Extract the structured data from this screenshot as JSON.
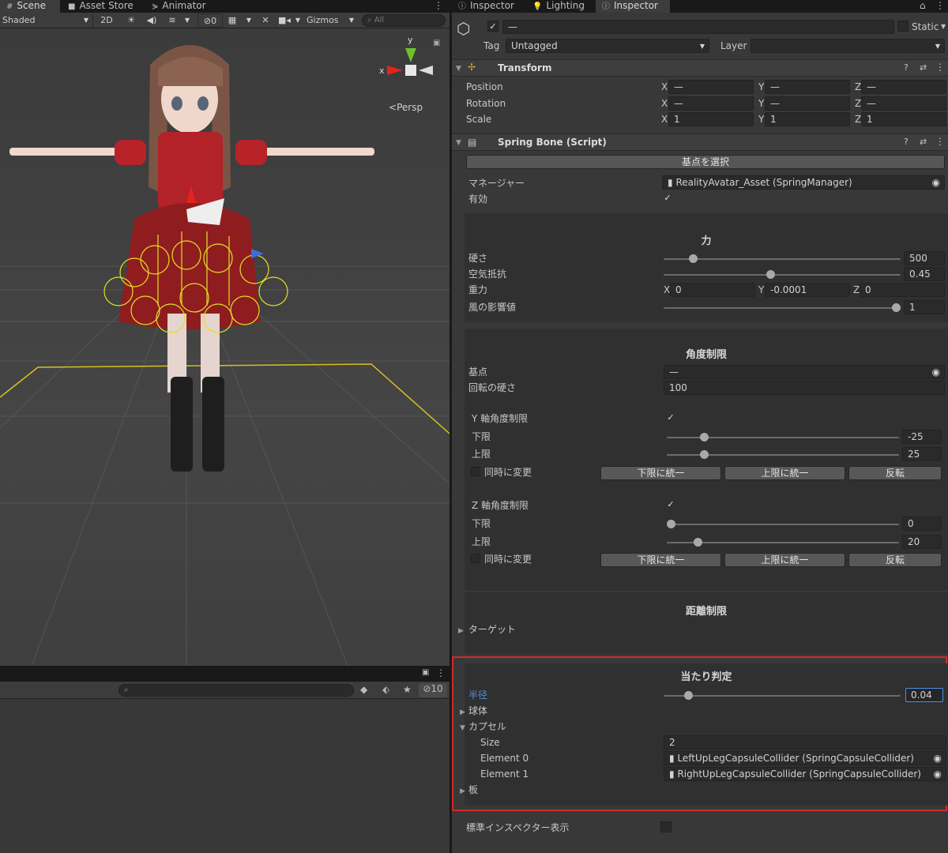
{
  "left_tabs": [
    {
      "label": "Scene"
    },
    {
      "label": "Asset Store"
    },
    {
      "label": "Animator"
    }
  ],
  "right_tabs": [
    {
      "label": "Inspector"
    },
    {
      "label": "Lighting"
    },
    {
      "label": "Inspector"
    }
  ],
  "scene_toolbar": {
    "shading": "Shaded",
    "mode_2d": "2D",
    "hidden_count": "0",
    "gizmos": "Gizmos",
    "search_placeholder": "All"
  },
  "scene": {
    "persp_label": "Persp",
    "gizmo_axes": {
      "x": "x",
      "y": "y"
    }
  },
  "hierarchy": {
    "hidden_count": "10"
  },
  "object": {
    "name": "—",
    "static_label": "Static",
    "tag_label": "Tag",
    "tag_value": "Untagged",
    "layer_label": "Layer",
    "layer_value": ""
  },
  "transform": {
    "title": "Transform",
    "rows": [
      {
        "label": "Position",
        "x": "—",
        "y": "—",
        "z": "—"
      },
      {
        "label": "Rotation",
        "x": "—",
        "y": "—",
        "z": "—"
      },
      {
        "label": "Scale",
        "x": "1",
        "y": "1",
        "z": "1"
      }
    ]
  },
  "spring_bone": {
    "title": "Spring Bone (Script)",
    "select_root_button": "基点を選択",
    "manager_label": "マネージャー",
    "manager_value": "RealityAvatar_Asset (SpringManager)",
    "enabled_label": "有効",
    "force": {
      "heading": "力",
      "stiffness": {
        "label": "硬さ",
        "value": "500",
        "fraction": 0.11
      },
      "drag": {
        "label": "空気抵抗",
        "value": "0.45",
        "fraction": 0.45
      },
      "gravity": {
        "label": "重力",
        "x": "0",
        "y": "-0.0001",
        "z": "0"
      },
      "wind": {
        "label": "風の影響値",
        "value": "1",
        "fraction": 1.0
      }
    },
    "angle_limit": {
      "heading": "角度制限",
      "pivot_label": "基点",
      "pivot_value": "—",
      "rotation_stiffness_label": "回転の硬さ",
      "rotation_stiffness_value": "100",
      "y_axis": {
        "label": "Y 軸角度制限",
        "min_label": "下限",
        "min_value": "-25",
        "min_fraction": 0.15,
        "max_label": "上限",
        "max_value": "25",
        "max_fraction": 0.15,
        "sync_label": "同時に変更",
        "btn_min": "下限に統一",
        "btn_max": "上限に統一",
        "btn_flip": "反転"
      },
      "z_axis": {
        "label": "Z 軸角度制限",
        "min_label": "下限",
        "min_value": "0",
        "min_fraction": 0.0,
        "max_label": "上限",
        "max_value": "20",
        "max_fraction": 0.12,
        "sync_label": "同時に変更",
        "btn_min": "下限に統一",
        "btn_max": "上限に統一",
        "btn_flip": "反転"
      }
    },
    "length_limit": {
      "heading": "距離制限",
      "target_label": "ターゲット"
    },
    "collision": {
      "heading": "当たり判定",
      "radius_label": "半径",
      "radius_value": "0.04",
      "radius_fraction": 0.09,
      "sphere_label": "球体",
      "capsule_label": "カプセル",
      "size_label": "Size",
      "size_value": "2",
      "elements": [
        {
          "label": "Element 0",
          "value": "LeftUpLegCapsuleCollider (SpringCapsuleCollider)"
        },
        {
          "label": "Element 1",
          "value": "RightUpLegCapsuleCollider (SpringCapsuleCollider)"
        }
      ],
      "plate_label": "板"
    },
    "default_inspector_label": "標準インスペクター表示"
  },
  "colors": {
    "highlight_box": "#d02a2a",
    "selected_label": "#4d8fe8",
    "background": "#383838"
  }
}
